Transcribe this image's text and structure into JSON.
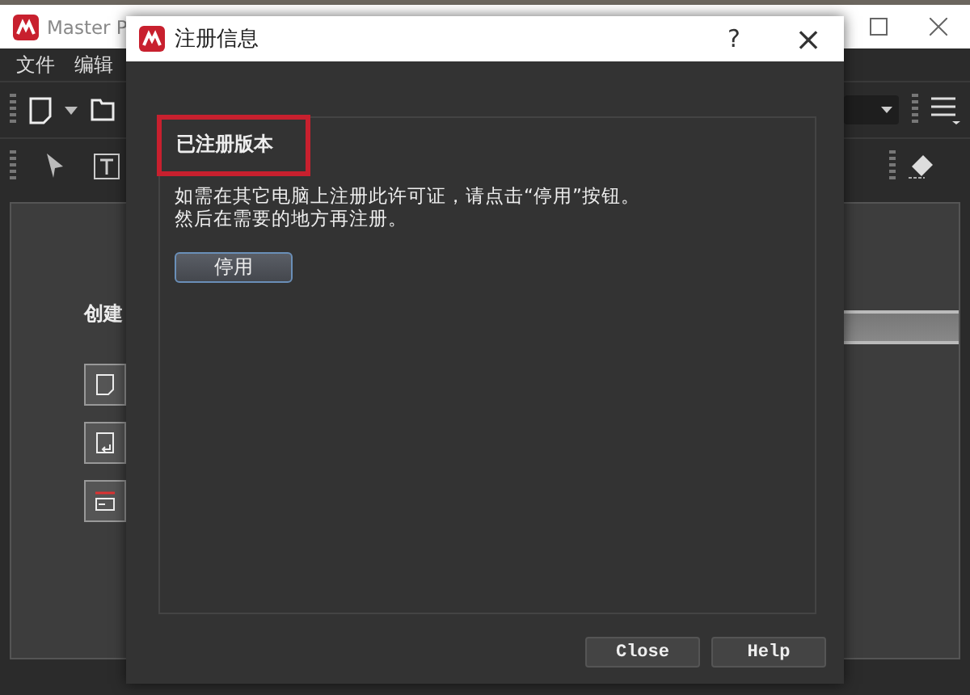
{
  "app": {
    "title": "Master P",
    "menu": [
      "文件",
      "编辑"
    ],
    "panel_heading": "创建"
  },
  "dialog": {
    "title": "注册信息",
    "help_glyph": "?",
    "close_glyph": "×",
    "section": {
      "heading": "已注册版本",
      "highlighted": true
    },
    "message": [
      "如需在其它电脑上注册此许可证，请点击“停用”按钮。",
      "然后在需要的地方再注册。"
    ],
    "deactivate_button": "停用",
    "buttons": [
      "Close",
      "Help"
    ]
  }
}
